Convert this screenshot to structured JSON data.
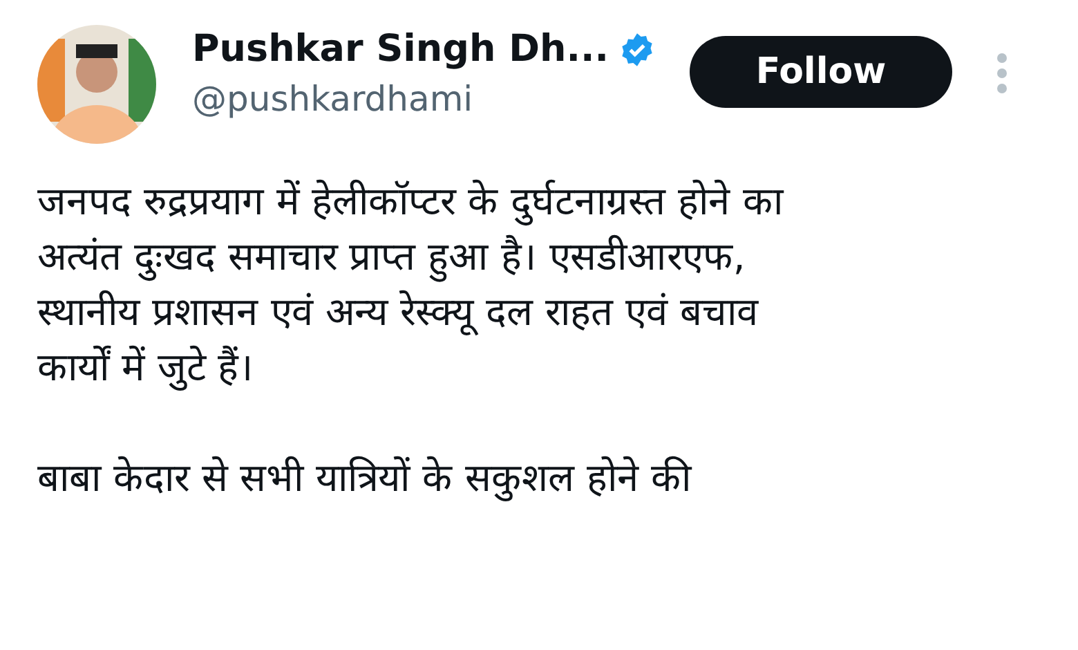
{
  "author": {
    "name": "Pushkar Singh Dh...",
    "handle": "@pushkardhami",
    "verified": true
  },
  "follow_button": {
    "label": "Follow"
  },
  "paragraphs": [
    {
      "lines": [
        "जनपद रुद्रप्रयाग में हेलीकॉप्टर के दुर्घटनाग्रस्त होने का",
        "अत्यंत दुःखद समाचार प्राप्त हुआ है। एसडीआरएफ,",
        "स्थानीय प्रशासन एवं अन्य रेस्क्यू दल राहत एवं बचाव",
        "कार्यों में जुटे हैं।"
      ]
    },
    {
      "lines": [
        "बाबा केदार से सभी यात्रियों के सकुशल होने की"
      ]
    }
  ]
}
